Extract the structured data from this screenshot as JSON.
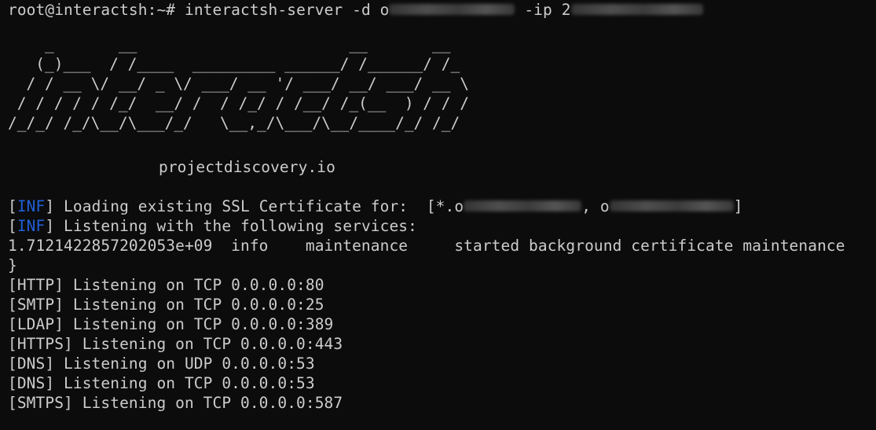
{
  "terminal": {
    "prompt_user_host": "root@interactsh",
    "prompt_path": ":~# ",
    "command_name": "interactsh-server",
    "flag_domain": " -d ",
    "domain_visible_prefix": "o",
    "flag_ip": " -ip ",
    "ip_visible_prefix": "2",
    "ascii_banner": "    _       __                       __       __\n   (_)___  / /____  _________ ______/ /______/ /_\n  / / __ \\/ __/ _ \\/ ___/ __ '/ ___/ __/ ___/ __ \\\n / / / / / /_/  __/ /  / /_/ / /__/ /_(__  ) / / /\n/_/_/ /_/\\__/\\___/_/   \\__,_/\\___/\\__/____/_/ /_/",
    "site": "projectdiscovery.io",
    "bracket_open": "[",
    "bracket_close": "]",
    "inf_tag": "INF",
    "ssl_message": " Loading existing SSL Certificate for:  [*.o",
    "ssl_separator": ", o",
    "ssl_end": "]",
    "listening_message": " Listening with the following services:",
    "maintenance_line": "1.7121422857202053e+09  info    maintenance     started background certificate maintenance",
    "closing_brace": "}",
    "services": [
      "[HTTP] Listening on TCP 0.0.0.0:80",
      "[SMTP] Listening on TCP 0.0.0.0:25",
      "[LDAP] Listening on TCP 0.0.0.0:389",
      "[HTTPS] Listening on TCP 0.0.0.0:443",
      "[DNS] Listening on UDP 0.0.0.0:53",
      "[DNS] Listening on TCP 0.0.0.0:53",
      "[SMTPS] Listening on TCP 0.0.0.0:587"
    ]
  },
  "colors": {
    "background": "#0c0c0c",
    "foreground": "#cccccc",
    "inf": "#1f5fd6"
  }
}
